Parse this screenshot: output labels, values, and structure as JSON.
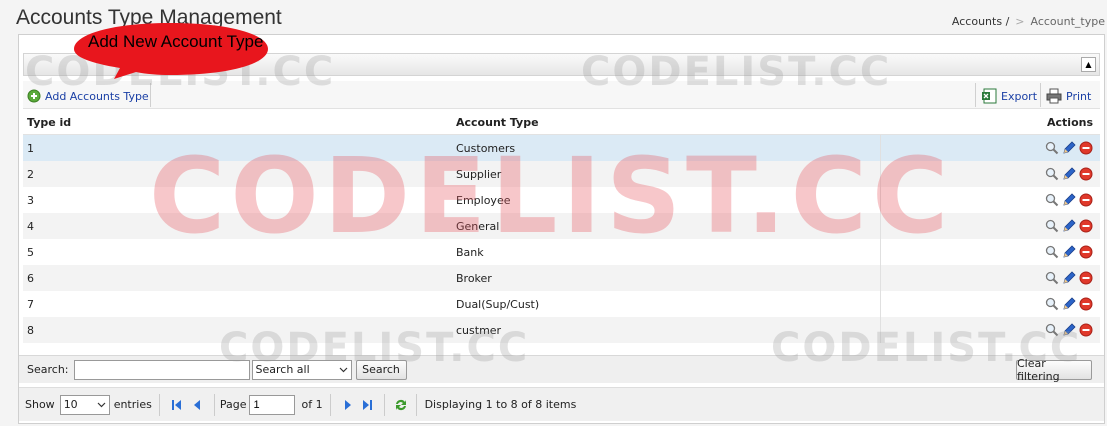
{
  "page": {
    "title": "Accounts Type Management"
  },
  "breadcrumb": {
    "parent": "Accounts /",
    "sep": ">",
    "current": "Account_type"
  },
  "callout": {
    "text": "Add New Account Type"
  },
  "toolbar": {
    "add_label": "Add Accounts Type",
    "export_label": "Export",
    "print_label": "Print"
  },
  "grid": {
    "columns": [
      "Type id",
      "Account Type",
      "Actions"
    ],
    "rows": [
      {
        "id": "1",
        "type": "Customers"
      },
      {
        "id": "2",
        "type": "Supplier"
      },
      {
        "id": "3",
        "type": "Employee"
      },
      {
        "id": "4",
        "type": "General"
      },
      {
        "id": "5",
        "type": "Bank"
      },
      {
        "id": "6",
        "type": "Broker"
      },
      {
        "id": "7",
        "type": "Dual(Sup/Cust)"
      },
      {
        "id": "8",
        "type": "custmer"
      }
    ]
  },
  "search": {
    "label": "Search:",
    "value": "",
    "scope": "Search all",
    "button": "Search",
    "clear": "Clear filtering"
  },
  "pager": {
    "show_label": "Show",
    "page_size": "10",
    "entries_label": "entries",
    "page_label": "Page",
    "page": "1",
    "of_label": "of 1",
    "status": "Displaying 1 to 8 of 8 items"
  },
  "watermark": {
    "text": "CODELIST.CC"
  },
  "icons": {
    "add": "add-circle-icon",
    "export": "excel-icon",
    "print": "printer-icon",
    "view": "magnifier-icon",
    "edit": "pencil-icon",
    "delete": "delete-circle-icon"
  },
  "colors": {
    "accent": "#1a3fa5",
    "callout": "#e8161d",
    "selected_row": "#dbeaf5",
    "watermark_big": "#e6505a"
  }
}
